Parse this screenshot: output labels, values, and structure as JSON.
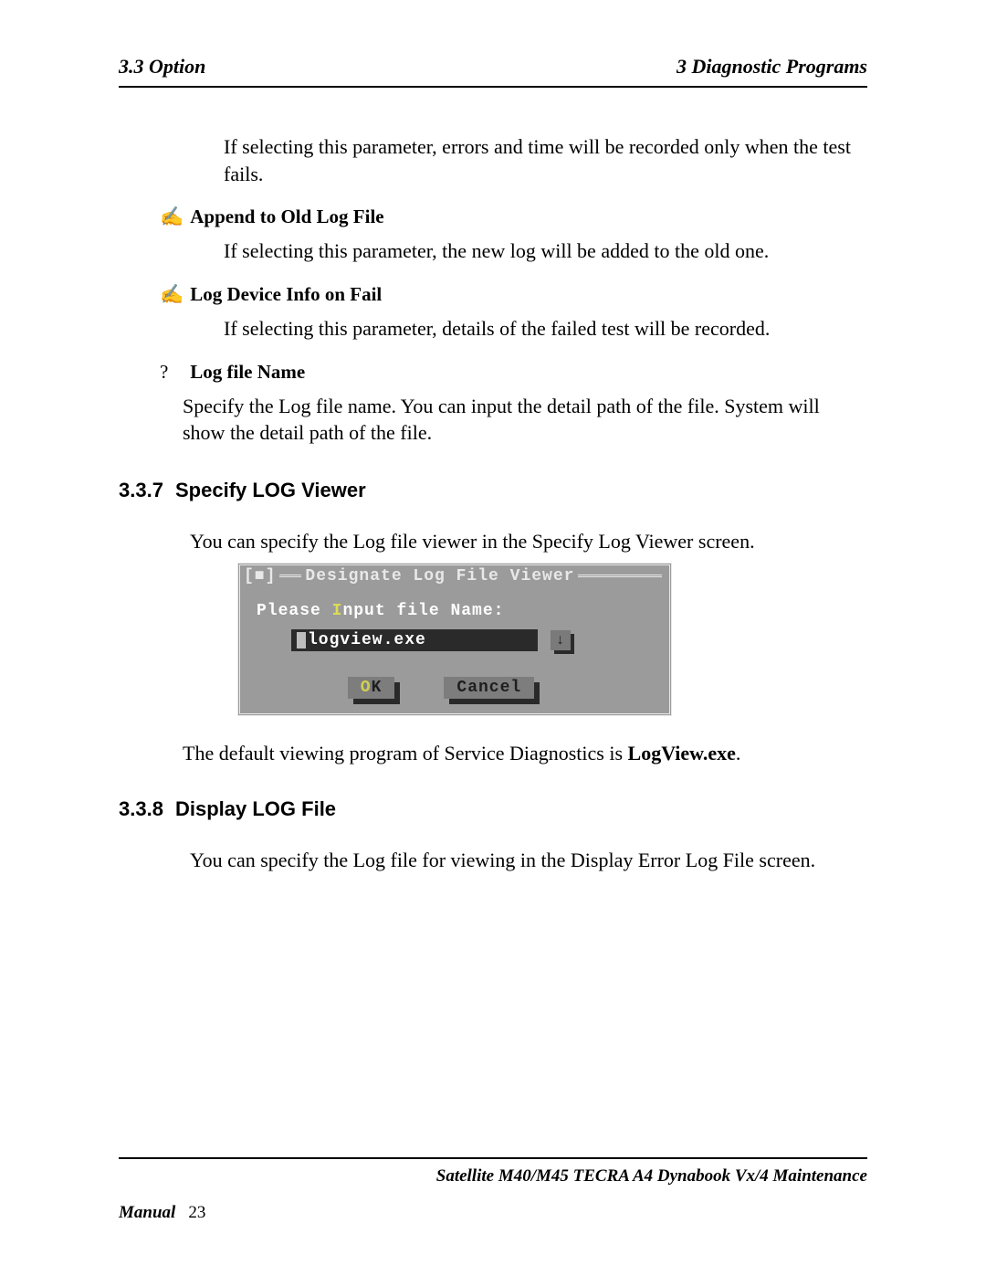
{
  "header": {
    "left": "3.3 Option",
    "right": "3  Diagnostic Programs"
  },
  "intro_para": "If selecting this parameter, errors and time will be recorded only when the test fails.",
  "bullets": [
    {
      "mark": "✍",
      "label": "Append to Old Log File",
      "desc": "If selecting this parameter, the new log will be added to the old one."
    },
    {
      "mark": "✍",
      "label": "Log Device Info on Fail",
      "desc": "If selecting this parameter, details of the failed test will be recorded."
    },
    {
      "mark": "?",
      "label": "Log file Name",
      "desc": "Specify the Log file name. You can input the detail path of the file. System will show the detail path of the file."
    }
  ],
  "sections": {
    "s337": {
      "num": "3.3.7",
      "title": "Specify LOG Viewer",
      "lead": "You can specify the Log file viewer in the Specify Log Viewer screen."
    },
    "s338": {
      "num": "3.3.8",
      "title": "Display LOG File",
      "lead": "You can specify the Log file for viewing in the Display Error Log File screen."
    }
  },
  "dialog": {
    "close_marker": "[■]",
    "title": "Designate Log File Viewer",
    "prompt_pre": "Please ",
    "prompt_hot": "I",
    "prompt_post": "nput file Name:",
    "input_value": "logview.exe",
    "history_glyph": "↓",
    "ok_hot": "O",
    "ok_rest": "K",
    "cancel": "Cancel"
  },
  "after_dialog": {
    "pre": "The default viewing program of Service Diagnostics is ",
    "bold": "LogView.exe",
    "post": "."
  },
  "footer": {
    "right": "Satellite M40/M45 TECRA A4 Dynabook Vx/4  Maintenance",
    "left_label": "Manual",
    "page": "23"
  }
}
